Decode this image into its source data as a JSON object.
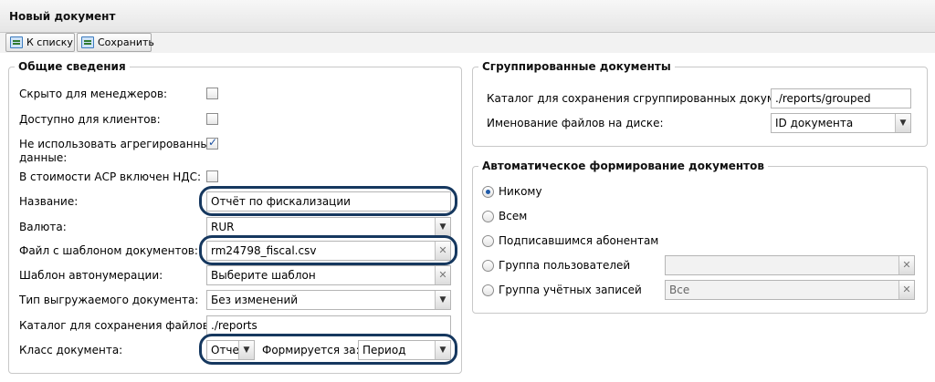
{
  "window": {
    "title": "Новый документ"
  },
  "toolbar": {
    "back_label": "К списку",
    "save_label": "Сохранить"
  },
  "general": {
    "legend": "Общие сведения",
    "hidden_for_managers": {
      "label": "Скрыто для менеджеров:",
      "checked": false
    },
    "available_for_clients": {
      "label": "Доступно для клиентов:",
      "checked": false
    },
    "no_aggregated_data": {
      "label_line1": "Не использовать агрегированные",
      "label_line2": "данные:",
      "checked": true
    },
    "asr_vat": {
      "label": "В стоимости АСР включен НДС:",
      "checked": false
    },
    "name": {
      "label": "Название:",
      "value": "Отчёт по фискализации"
    },
    "currency": {
      "label": "Валюта:",
      "value": "RUR"
    },
    "template_file": {
      "label": "Файл с шаблоном документов:",
      "value": "rm24798_fiscal.csv"
    },
    "autonumber_template": {
      "label": "Шаблон автонумерации:",
      "value": "Выберите шаблон"
    },
    "export_type": {
      "label": "Тип выгружаемого документа:",
      "value": "Без изменений"
    },
    "files_dir": {
      "label": "Каталог для сохранения файлов:",
      "value": "./reports"
    },
    "doc_class": {
      "label": "Класс документа:",
      "value": "Отчет"
    },
    "formed_for": {
      "label": "Формируется за:",
      "value": "Период"
    }
  },
  "grouped": {
    "legend": "Сгруппированные документы",
    "dir": {
      "label": "Каталог для сохранения сгруппированных документов:",
      "value": "./reports/grouped"
    },
    "file_naming": {
      "label": "Именование файлов на диске:",
      "value": "ID документа"
    }
  },
  "auto": {
    "legend": "Автоматическое формирование документов",
    "options": [
      {
        "label": "Никому",
        "checked": true
      },
      {
        "label": "Всем",
        "checked": false
      },
      {
        "label": "Подписавшимся абонентам",
        "checked": false
      },
      {
        "label": "Группа пользователей",
        "checked": false,
        "value": ""
      },
      {
        "label": "Группа учётных записей",
        "checked": false,
        "value": "Все"
      }
    ]
  }
}
